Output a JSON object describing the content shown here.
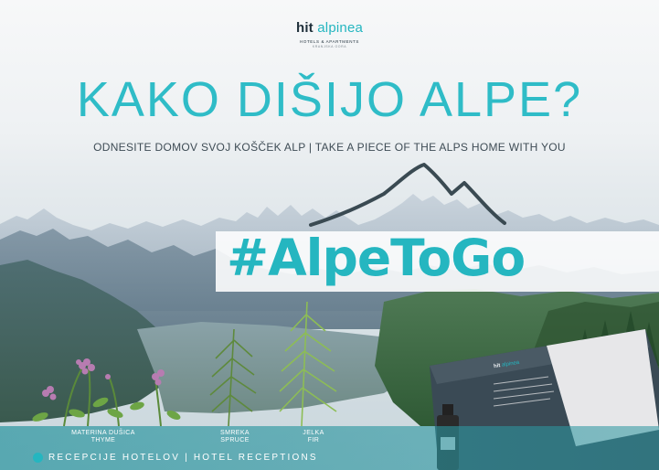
{
  "brand": {
    "hit": "hit",
    "alpinea": "alpinea",
    "subtitle": "HOTELS & APARTMENTS",
    "tagline": "KRANJSKA GORA"
  },
  "headline": "KAKO DIŠIJO ALPE?",
  "subline": "ODNESITE DOMOV SVOJ KOŠČEK ALP  |  TAKE A PIECE OF THE ALPS HOME WITH YOU",
  "hashtag": "#AlpeToGo",
  "herbs": [
    {
      "line1": "MATERINA DUŠICA",
      "line2": "THYME"
    },
    {
      "line1": "SMREKA",
      "line2": "SPRUCE"
    },
    {
      "line1": "JELKA",
      "line2": "FIR"
    }
  ],
  "reception": "RECEPCIJE HOTELOV  |  HOTEL RECEPTIONS",
  "product_box": {
    "brand_hit": "hit",
    "brand_alpinea": "alpinea"
  },
  "colors": {
    "accent": "#25b6c0",
    "dark": "#1f2f3a",
    "text": "#3e4c55"
  }
}
